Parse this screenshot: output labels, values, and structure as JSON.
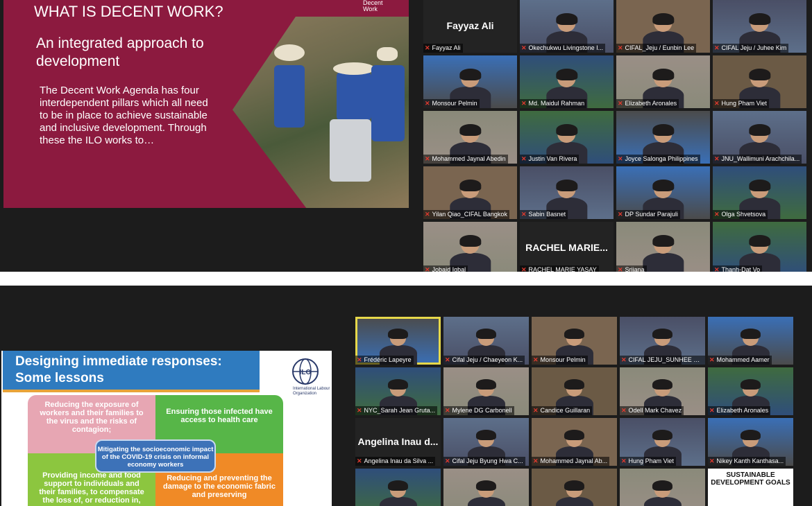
{
  "top": {
    "slide": {
      "logo": [
        "Decent",
        "Work"
      ],
      "title": "WHAT IS DECENT WORK?",
      "subtitle": "An integrated approach to development",
      "body": "The Decent Work Agenda has four interdependent pillars which all need to be in place to achieve sustainable and inclusive  development. Through these the ILO works to…"
    },
    "participants": [
      {
        "name": "Fayyaz Ali",
        "big": "Fayyaz Ali"
      },
      {
        "name": "Okechukwu Livingstone I..."
      },
      {
        "name": "CIFAL_Jeju / Eunbin Lee"
      },
      {
        "name": "CIFAL Jeju / Juhee Kim"
      },
      {
        "name": "Monsour Pelmin"
      },
      {
        "name": "Md. Maidul Rahman"
      },
      {
        "name": "Elizabeth Aronales"
      },
      {
        "name": "Hung Pham Viet"
      },
      {
        "name": "Mohammed Jaynal Abedin"
      },
      {
        "name": "Justin Van Rivera"
      },
      {
        "name": "Joyce Salonga Philippines"
      },
      {
        "name": "JNU_Wallimuni Arachchila..."
      },
      {
        "name": "Yilan Qiao_CIFAL Bangkok"
      },
      {
        "name": "Sabin Basnet"
      },
      {
        "name": "DP Sundar Parajuli"
      },
      {
        "name": "Olga Shvetsova"
      },
      {
        "name": "Jobaid Iqbal"
      },
      {
        "name": "RACHEL MARIE YASAY",
        "big": "RACHEL  MARIE..."
      },
      {
        "name": "Srijana"
      },
      {
        "name": "Thanh-Dat Vo"
      }
    ]
  },
  "bottom": {
    "slide": {
      "title": "Designing immediate responses: Some lessons",
      "logo_text": "International Labour Organization",
      "q1": "Reducing the exposure of workers and their families to the virus and the risks of contagion;",
      "q2": "Ensuring those infected have access to health care",
      "q3": "Providing income and food support to individuals and their families, to compensate the loss of, or reduction in,",
      "q4": "Reducing and preventing the damage to the economic fabric and preserving",
      "center": "Mitigating the socioeconomic impact of the COVID-19 crisis on informal economy workers"
    },
    "participants": [
      {
        "name": "Frédéric Lapeyre"
      },
      {
        "name": "Cifal Jeju / Chaeyeon K..."
      },
      {
        "name": "Monsour Pelmin"
      },
      {
        "name": "CIFAL JEJU_SUNHEE C..."
      },
      {
        "name": "Mohammed Aamer"
      },
      {
        "name": "NYC_Sarah Jean Gruta..."
      },
      {
        "name": "Mylene DG Carbonell"
      },
      {
        "name": "Candice Guillaran"
      },
      {
        "name": "Odell Mark Chavez"
      },
      {
        "name": "Elizabeth Aronales"
      },
      {
        "name": "Angelina Inau da Silva ...",
        "big": "Angelina Inau d..."
      },
      {
        "name": "Cifal Jeju Byung Hwa C..."
      },
      {
        "name": "Mohammed Jaynal Ab..."
      },
      {
        "name": "Hung Pham Viet"
      },
      {
        "name": "Nikey Kanth Kanthasa..."
      },
      {
        "name": ""
      },
      {
        "name": ""
      },
      {
        "name": ""
      },
      {
        "name": ""
      },
      {
        "name": "",
        "big_logo": "SUSTAINABLE DEVELOPMENT GOALS"
      }
    ]
  },
  "colors": {
    "slide_maroon": "#8c1a3f",
    "ilo_blue": "#2f7bbf",
    "mic_red": "#e03a2e",
    "active_speaker": "#e6d84a"
  }
}
